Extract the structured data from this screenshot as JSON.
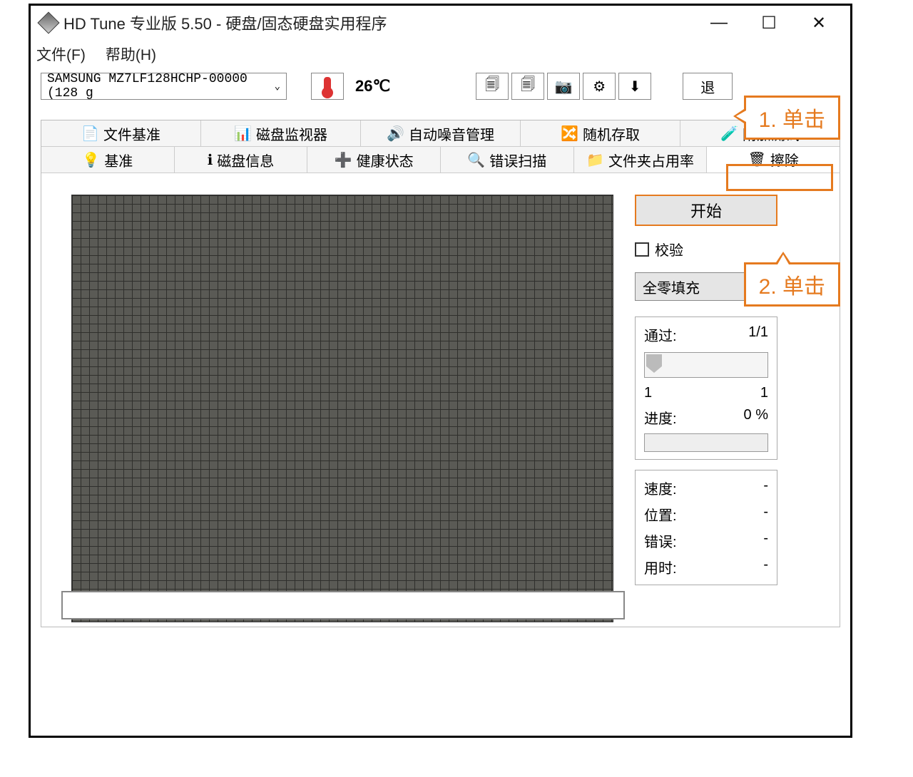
{
  "window": {
    "title": "HD Tune 专业版 5.50 - 硬盘/固态硬盘实用程序"
  },
  "menu": {
    "file": "文件(F)",
    "help": "帮助(H)"
  },
  "toolbar": {
    "drive": "SAMSUNG MZ7LF128HCHP-00000 (128 g",
    "temp": "26℃",
    "exit": "退"
  },
  "tabs_row1": {
    "t0": "文件基准",
    "t1": "磁盘监视器",
    "t2": "自动噪音管理",
    "t3": "随机存取",
    "t4": "附加测试"
  },
  "tabs_row2": {
    "t0": "基准",
    "t1": "磁盘信息",
    "t2": "健康状态",
    "t3": "错误扫描",
    "t4": "文件夹占用率",
    "t5": "擦除"
  },
  "side": {
    "start": "开始",
    "verify": "校验",
    "fill": "全零填充",
    "pass_label": "通过:",
    "pass_value": "1/1",
    "range_low": "1",
    "range_high": "1",
    "progress_label": "进度:",
    "progress_value": "0 %",
    "speed_label": "速度:",
    "speed_value": "-",
    "position_label": "位置:",
    "position_value": "-",
    "errors_label": "错误:",
    "errors_value": "-",
    "time_label": "用时:",
    "time_value": "-"
  },
  "callouts": {
    "c1": "1. 单击",
    "c2": "2. 单击"
  }
}
